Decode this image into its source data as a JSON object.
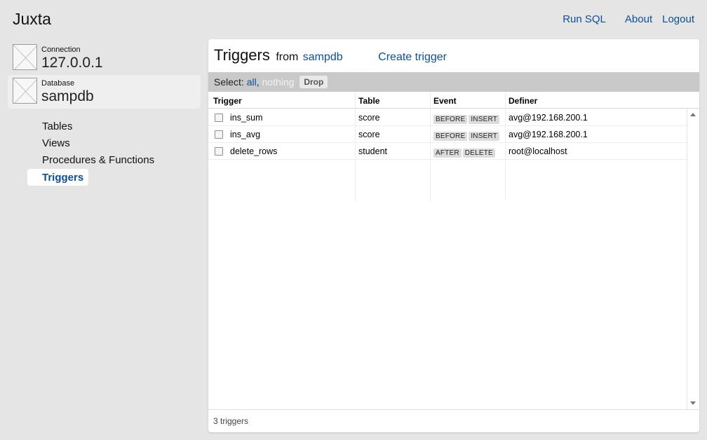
{
  "app": {
    "title": "Juxta"
  },
  "topnav": {
    "run_sql": "Run SQL",
    "about": "About",
    "logout": "Logout"
  },
  "connection": {
    "label": "Connection",
    "value": "127.0.0.1"
  },
  "database": {
    "label": "Database",
    "value": "sampdb"
  },
  "sidebar": {
    "items": [
      {
        "label": "Tables"
      },
      {
        "label": "Views"
      },
      {
        "label": "Procedures & Functions"
      },
      {
        "label": "Triggers"
      }
    ]
  },
  "panel": {
    "title": "Triggers",
    "from": "from",
    "database": "sampdb",
    "create": "Create trigger"
  },
  "selection": {
    "prefix": "Select:",
    "all": "all",
    "sep": ",",
    "nothing": "nothing",
    "drop": "Drop"
  },
  "table": {
    "columns": [
      "Trigger",
      "Table",
      "Event",
      "Definer"
    ],
    "rows": [
      {
        "trigger": "ins_sum",
        "table": "score",
        "timing": "BEFORE",
        "event": "INSERT",
        "definer": "avg@192.168.200.1"
      },
      {
        "trigger": "ins_avg",
        "table": "score",
        "timing": "BEFORE",
        "event": "INSERT",
        "definer": "avg@192.168.200.1"
      },
      {
        "trigger": "delete_rows",
        "table": "student",
        "timing": "AFTER",
        "event": "DELETE",
        "definer": "root@localhost"
      }
    ]
  },
  "footer": {
    "count": "3 triggers"
  },
  "colors": {
    "link": "#0b4f96",
    "background": "#e5e5e5",
    "selbar": "#c9c9c9"
  }
}
